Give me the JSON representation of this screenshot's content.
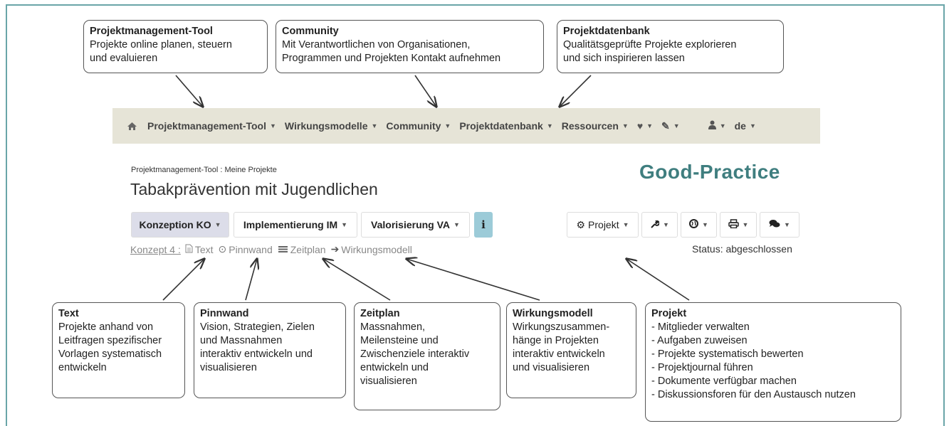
{
  "callouts_top": [
    {
      "title": "Projektmanagement-Tool",
      "text": "Projekte online planen, steuern\nund evaluieren"
    },
    {
      "title": "Community",
      "text": "Mit Verantwortlichen von Organisationen,\nProgrammen und Projekten Kontakt aufnehmen"
    },
    {
      "title": "Projektdatenbank",
      "text": "Qualitätsgeprüfte Projekte explorieren\nund sich inspirieren lassen"
    }
  ],
  "navbar": {
    "home_icon": "home-icon",
    "items": [
      "Projektmanagement-Tool",
      "Wirkungsmodelle",
      "Community",
      "Projektdatenbank",
      "Ressourcen"
    ],
    "heart_icon": "heart-icon",
    "pencil_icon": "pencil-icon",
    "user_icon": "user-icon",
    "language": "de"
  },
  "breadcrumb": {
    "section": "Projektmanagement-Tool",
    "separator": " : ",
    "page": "Meine Projekte"
  },
  "page_title": "Tabakprävention mit Jugendlichen",
  "logo": "Good-Practice",
  "phases": [
    {
      "label": "Konzeption KO",
      "active": true
    },
    {
      "label": "Implementierung IM",
      "active": false
    },
    {
      "label": "Valorisierung VA",
      "active": false
    }
  ],
  "info_button": "i",
  "toolbar": {
    "project_label": "Projekt",
    "icons": [
      "gear-icon",
      "wrench-icon",
      "globe-icon",
      "print-icon",
      "comments-icon"
    ]
  },
  "status": "Status: abgeschlossen",
  "subnav": {
    "concept": "Konzept 4 :",
    "items": [
      "Text",
      "Pinnwand",
      "Zeitplan",
      "Wirkungsmodell"
    ]
  },
  "callouts_bottom": [
    {
      "title": "Text",
      "text": "Projekte anhand von\nLeitfragen spezifischer\nVorlagen systematisch\nentwickeln"
    },
    {
      "title": "Pinnwand",
      "text": "Vision, Strategien, Zielen\nund Massnahmen\ninteraktiv entwickeln und\nvisualisieren"
    },
    {
      "title": "Zeitplan",
      "text": "Massnahmen,\nMeilensteine und\nZwischenziele interaktiv\nentwickeln und\nvisualisieren"
    },
    {
      "title": "Wirkungsmodell",
      "text": "Wirkungszusammen-\nhänge in Projekten\ninteraktiv entwickeln\nund visualisieren"
    },
    {
      "title": "Projekt",
      "text": "- Mitglieder verwalten\n- Aufgaben zuweisen\n- Projekte systematisch bewerten\n- Projektjournal führen\n- Dokumente verfügbar machen\n- Diskussionsforen für den Austausch nutzen"
    }
  ]
}
